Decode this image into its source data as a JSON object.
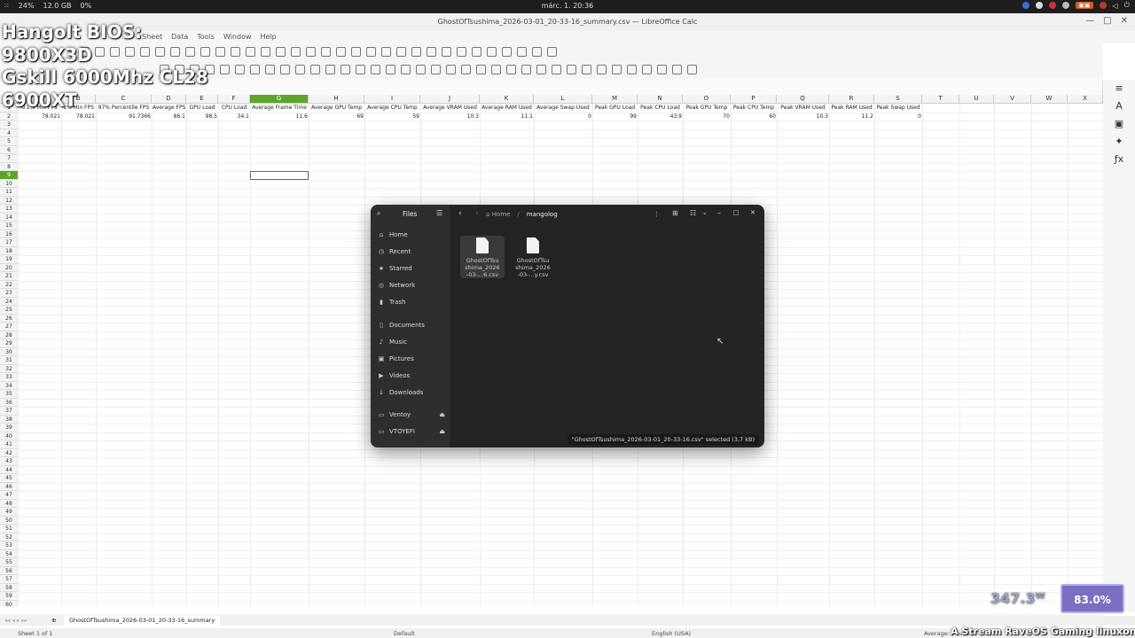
{
  "topbar": {
    "cpu": "24%",
    "ram": "12.0 GB",
    "extra": "0%",
    "clock": "márc. 1. 20:36"
  },
  "window": {
    "title": "GhostOfTsushima_2026-03-01_20-33-16_summary.csv — LibreOffice Calc"
  },
  "menu": [
    "Sheet",
    "Data",
    "Tools",
    "Window",
    "Help"
  ],
  "overlay_lines": [
    "Hangolt BIOS:",
    "9800X3D",
    "Gskill 6000Mhz CL28",
    "6900XT"
  ],
  "columns": [
    "A",
    "B",
    "C",
    "D",
    "E",
    "F",
    "G",
    "H",
    "I",
    "J",
    "K",
    "L",
    "M",
    "N",
    "O",
    "P",
    "Q",
    "R",
    "S",
    "T",
    "U",
    "V",
    "W",
    "X"
  ],
  "header_row": [
    "0.1% Min FPS",
    "1% Min FPS",
    "97% Percentile FPS",
    "Average FPS",
    "GPU Load",
    "CPU Load",
    "Average Frame Time",
    "Average GPU Temp",
    "Average CPU Temp",
    "Average VRAM Used",
    "Average RAM Used",
    "Average Swap Used",
    "Peak GPU Load",
    "Peak CPU Load",
    "Peak GPU Temp",
    "Peak CPU Temp",
    "Peak VRAM Used",
    "Peak RAM Used",
    "Peak Swap Used"
  ],
  "value_row": [
    "78.021",
    "78.021",
    "91.7366",
    "86.1",
    "98.5",
    "34.1",
    "11.6",
    "69",
    "59",
    "10.3",
    "11.1",
    "0",
    "99",
    "43.9",
    "70",
    "60",
    "10.3",
    "11.2",
    "0"
  ],
  "row_numbers": [
    "1",
    "2",
    "3",
    "4",
    "5",
    "6",
    "7",
    "8",
    "9",
    "10",
    "11",
    "12",
    "13",
    "14",
    "15",
    "16",
    "17",
    "18",
    "19",
    "20",
    "21",
    "22",
    "23",
    "24",
    "25",
    "26",
    "27",
    "28",
    "29",
    "30",
    "31",
    "32",
    "33",
    "34",
    "35",
    "36",
    "37",
    "38",
    "39",
    "40",
    "41",
    "42",
    "43",
    "44",
    "45",
    "46",
    "47",
    "48",
    "49",
    "50",
    "51",
    "52",
    "53",
    "54",
    "55",
    "56",
    "57",
    "58",
    "59",
    "60"
  ],
  "files": {
    "sidebar_title": "Files",
    "places": [
      {
        "label": "Home",
        "icon": "home-icon",
        "glyph": "⌂"
      },
      {
        "label": "Recent",
        "icon": "clock-icon",
        "glyph": "◷"
      },
      {
        "label": "Starred",
        "icon": "star-icon",
        "glyph": "★"
      },
      {
        "label": "Network",
        "icon": "network-icon",
        "glyph": "◎"
      },
      {
        "label": "Trash",
        "icon": "trash-icon",
        "glyph": "▮"
      },
      {
        "label": "Documents",
        "icon": "document-icon",
        "glyph": "▯"
      },
      {
        "label": "Music",
        "icon": "music-icon",
        "glyph": "♪"
      },
      {
        "label": "Pictures",
        "icon": "picture-icon",
        "glyph": "▣"
      },
      {
        "label": "Videos",
        "icon": "video-icon",
        "glyph": "▶"
      },
      {
        "label": "Downloads",
        "icon": "download-icon",
        "glyph": "↓"
      },
      {
        "label": "Ventoy",
        "icon": "drive-icon",
        "glyph": "▭"
      },
      {
        "label": "VTOYEFI",
        "icon": "drive-icon",
        "glyph": "▭"
      }
    ],
    "path": [
      "Home",
      "mangolog"
    ],
    "items": [
      {
        "name": "GhostOfTsushima_2026-03-...6.csv",
        "line1": "GhostOfTsu",
        "line2": "shima_2026",
        "line3": "-03-...6.csv",
        "selected": true
      },
      {
        "name": "GhostOfTsushima_2026-03-...y.csv",
        "line1": "GhostOfTsu",
        "line2": "shima_2026",
        "line3": "-03-...y.csv",
        "selected": false
      }
    ],
    "status": "\"GhostOfTsushima_2026-03-01_20-33-16.csv\" selected (3,7 kB)"
  },
  "sheet_tab": "GhostOfTsushima_2026-03-01_20-33-16_summary",
  "status": {
    "sheet": "Sheet 1 of 1",
    "style": "Default",
    "lang": "English (USA)",
    "average": "Average: ; Sum: 0"
  },
  "power": "347.3ᵂ",
  "gpu_load": "83.0%",
  "ticker": "A Stream RaveOS Gaming linuxon fut"
}
